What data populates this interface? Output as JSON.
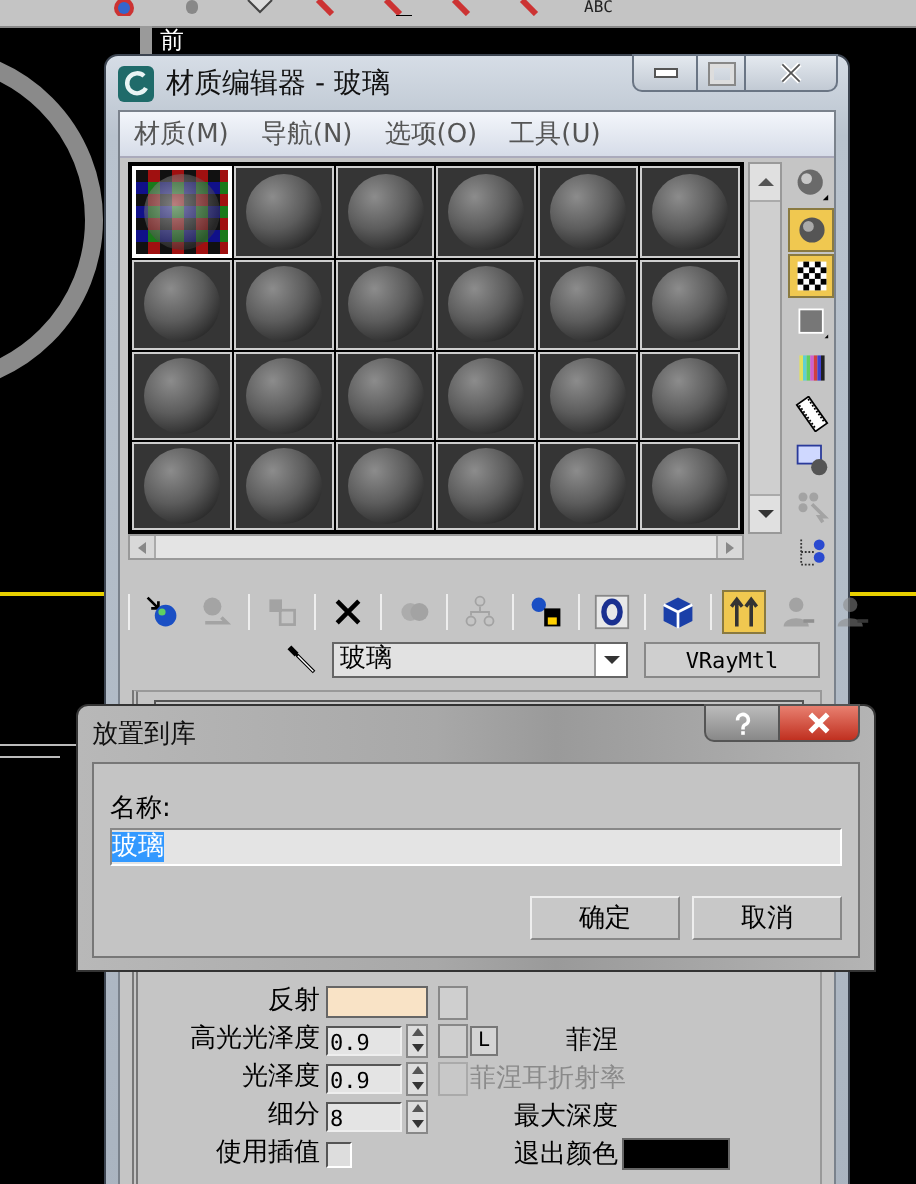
{
  "top_toolbar": {
    "label": "ABC"
  },
  "viewport": {
    "label": "前"
  },
  "material_editor": {
    "title": "材质编辑器 - 玻璃",
    "menu": [
      "材质(M)",
      "导航(N)",
      "选项(O)",
      "工具(U)"
    ],
    "slots": [
      {
        "selected": true
      },
      {
        "selected": false
      },
      {
        "selected": false
      },
      {
        "selected": false
      },
      {
        "selected": false
      },
      {
        "selected": false
      },
      {
        "selected": false
      },
      {
        "selected": false
      },
      {
        "selected": false
      },
      {
        "selected": false
      },
      {
        "selected": false
      },
      {
        "selected": false
      },
      {
        "selected": false
      },
      {
        "selected": false
      },
      {
        "selected": false
      },
      {
        "selected": false
      },
      {
        "selected": false
      },
      {
        "selected": false
      },
      {
        "selected": false
      },
      {
        "selected": false
      },
      {
        "selected": false
      },
      {
        "selected": false
      },
      {
        "selected": false
      },
      {
        "selected": false
      }
    ],
    "side_tools": [
      {
        "selected": false,
        "disabled": false
      },
      {
        "selected": true,
        "disabled": false
      },
      {
        "selected": true,
        "disabled": false
      },
      {
        "selected": false,
        "disabled": false
      },
      {
        "selected": false,
        "disabled": false
      },
      {
        "selected": false,
        "disabled": false
      },
      {
        "selected": false,
        "disabled": false
      },
      {
        "selected": false,
        "disabled": true
      },
      {
        "selected": false,
        "disabled": false
      }
    ],
    "tools": [
      {
        "selected": false,
        "disabled": false
      },
      {
        "selected": false,
        "disabled": true
      },
      {
        "selected": false,
        "disabled": true
      },
      {
        "selected": false,
        "disabled": false
      },
      {
        "selected": false,
        "disabled": true
      },
      {
        "selected": false,
        "disabled": true
      },
      {
        "selected": false,
        "disabled": false
      },
      {
        "selected": false,
        "disabled": false
      },
      {
        "selected": false,
        "disabled": false
      },
      {
        "selected": true,
        "disabled": false
      },
      {
        "selected": false,
        "disabled": true
      },
      {
        "selected": false,
        "disabled": true
      }
    ],
    "material_name": "玻璃",
    "material_type": "VRayMtl",
    "params": [
      {
        "kind": "color",
        "label": "反射",
        "color": "#f9e3c6",
        "map_button": {
          "disabled": false
        }
      },
      {
        "kind": "spinner",
        "label": "高光光泽度",
        "value": "0.9",
        "map_button": {
          "disabled": false
        },
        "lock": "L"
      },
      {
        "kind": "spinner",
        "label": "光泽度",
        "value": "0.9",
        "map_button": {
          "disabled": true
        }
      },
      {
        "kind": "spinner",
        "label": "细分",
        "value": "8"
      },
      {
        "kind": "checkbox",
        "label": "使用插值",
        "checked": false
      }
    ],
    "side_params": [
      {
        "kind": "text",
        "label": "菲涅",
        "disabled": false
      },
      {
        "kind": "text",
        "label": "菲涅耳折射率",
        "disabled": true
      },
      {
        "kind": "text",
        "label": "最大深度",
        "disabled": false
      },
      {
        "kind": "color",
        "label": "退出颜色",
        "color": "#000000"
      }
    ]
  },
  "dialog": {
    "title": "放置到库",
    "name_label": "名称:",
    "name_value": "玻璃",
    "buttons": [
      "确定",
      "取消"
    ]
  }
}
